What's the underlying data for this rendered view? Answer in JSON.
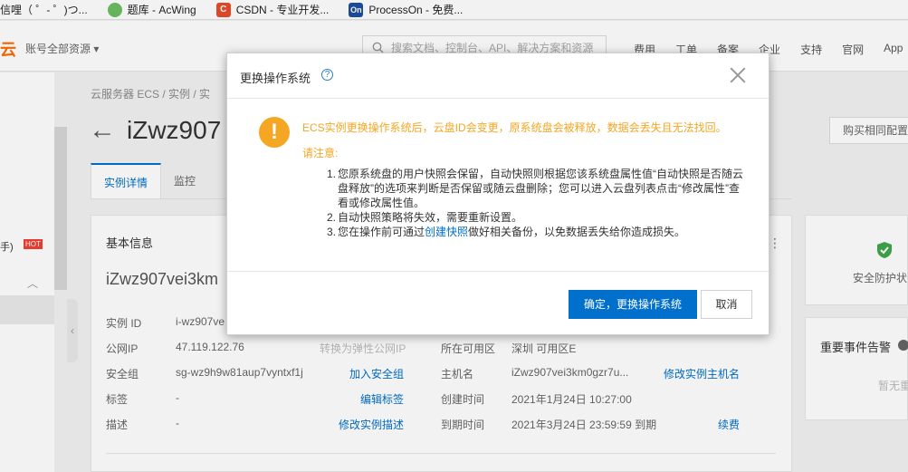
{
  "bookmarks": [
    {
      "label": "信哩（ ゜- ゜)つ...",
      "icon": "emoticon-bookmark-icon"
    },
    {
      "label": "题库 - AcWing",
      "icon": "acwing-icon"
    },
    {
      "label": "CSDN - 专业开发...",
      "icon": "csdn-icon",
      "mark": "C"
    },
    {
      "label": "ProcessOn - 免费...",
      "icon": "processon-icon",
      "mark": "On"
    }
  ],
  "topnav": {
    "logo": "云",
    "account": "账号全部资源 ▾",
    "search_placeholder": "搜索文档、控制台、API、解决方案和资源",
    "menu": [
      "费用",
      "工单",
      "备案",
      "企业",
      "支持",
      "官网",
      "App"
    ]
  },
  "sidebar": {
    "hot_item_text": "手)",
    "hot_badge": "HOT"
  },
  "page": {
    "breadcrumb": "云服务器 ECS / 实例 / 实",
    "back": "←",
    "title": "iZwz907",
    "buy_same": "购买相同配置",
    "tabs": [
      "实例详情",
      "监控"
    ]
  },
  "basic_info": {
    "title": "基本信息",
    "instance_name": "iZwz907vei3km",
    "rows": [
      {
        "label": "实例 ID",
        "value": "i-wz907ve",
        "link": "",
        "label2": "",
        "value2": "",
        "link2": ""
      },
      {
        "label": "公网IP",
        "value": "47.119.122.76",
        "muted": "转换为弹性公网IP",
        "label2": "所在可用区",
        "value2": "深圳 可用区E",
        "link2": ""
      },
      {
        "label": "安全组",
        "value": "sg-wz9h9w81aup7vyntxf1j",
        "link": "加入安全组",
        "label2": "主机名",
        "value2": "iZwz907vei3km0gzr7u...",
        "link2": "修改实例主机名"
      },
      {
        "label": "标签",
        "value": "-",
        "link": "编辑标签",
        "label2": "创建时间",
        "value2": "2021年1月24日 10:27:00",
        "link2": ""
      },
      {
        "label": "描述",
        "value": "-",
        "link": "修改实例描述",
        "label2": "到期时间",
        "value2": "2021年3月24日 23:59:59 到期",
        "link2": "续费"
      }
    ]
  },
  "right_cards": {
    "security": "安全防护状",
    "alerts_title": "重要事件告警",
    "alerts_empty": "暂无重"
  },
  "modal": {
    "title": "更换操作系统",
    "warning": "ECS实例更换操作系统后，云盘ID会变更，原系统盘会被释放，数据会丢失且无法找回。",
    "note_label": "请注意:",
    "notes": [
      {
        "num": "1.",
        "text": "您原系统盘的用户快照会保留，自动快照则根据您该系统盘属性值“自动快照是否随云盘释放”的选项来判断是否保留或随云盘删除；您可以进入云盘列表点击“修改属性”查看或修改属性值。"
      },
      {
        "num": "2.",
        "text": "自动快照策略将失效，需要重新设置。"
      },
      {
        "num": "3.",
        "pre": "您在操作前可通过",
        "link": "创建快照",
        "post": "做好相关备份，以免数据丢失给你造成损失。"
      }
    ],
    "confirm": "确定，更换操作系统",
    "cancel": "取消"
  },
  "colors": {
    "accent": "#0070cc",
    "warning": "#f5a623",
    "brand": "#ff6a00"
  }
}
